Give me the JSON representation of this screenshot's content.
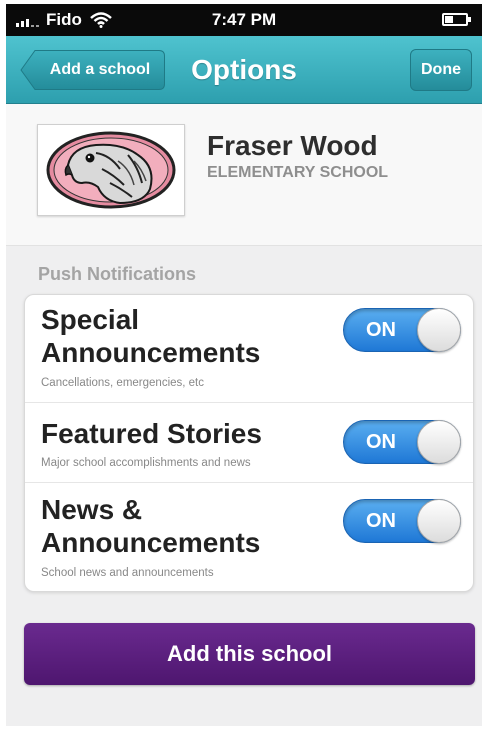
{
  "status_bar": {
    "carrier": "Fido",
    "time": "7:47 PM"
  },
  "navbar": {
    "back_label": "Add a school",
    "title": "Options",
    "done_label": "Done"
  },
  "school": {
    "name": "Fraser Wood",
    "type": "ELEMENTARY SCHOOL",
    "logo_icon": "falcon-mascot-logo"
  },
  "push_notifications": {
    "section_title": "Push Notifications",
    "items": [
      {
        "title": "Special Announcements",
        "title_lines": [
          "Special",
          "Announcements"
        ],
        "subtitle": "Cancellations, emergencies, etc",
        "toggle": "ON"
      },
      {
        "title": "Featured Stories",
        "subtitle": "Major school accomplishments and news",
        "toggle": "ON"
      },
      {
        "title": "News & Announcements",
        "title_lines": [
          "News &",
          "Announcements"
        ],
        "subtitle": "School news and announcements",
        "toggle": "ON"
      }
    ]
  },
  "add_button_label": "Add this school",
  "colors": {
    "navbar": "#3bb2c0",
    "toggle_on": "#2f88e0",
    "add_button": "#5c1f80"
  }
}
